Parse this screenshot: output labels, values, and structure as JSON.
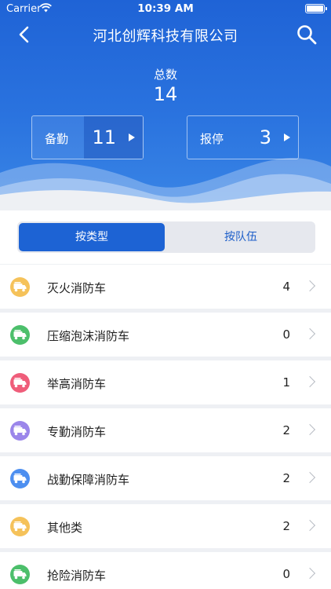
{
  "status_bar": {
    "carrier": "Carrier",
    "time": "10:39 AM"
  },
  "nav": {
    "title": "河北创辉科技有限公司",
    "back_icon": "chevron-left-icon",
    "search_icon": "search-icon"
  },
  "summary": {
    "total_label": "总数",
    "total_value": "14",
    "on_duty": {
      "label": "备勤",
      "value": "11"
    },
    "off_duty": {
      "label": "报停",
      "value": "3"
    }
  },
  "segment": {
    "by_type": "按类型",
    "by_team": "按队伍",
    "selected": "按类型"
  },
  "categories": [
    {
      "name": "灭火消防车",
      "count": "4",
      "icon": "fire-truck-icon",
      "color": "#f5c25a"
    },
    {
      "name": "压缩泡沫消防车",
      "count": "0",
      "icon": "fire-truck-icon",
      "color": "#4cbf6b"
    },
    {
      "name": "举高消防车",
      "count": "1",
      "icon": "fire-truck-icon",
      "color": "#ef5d7a"
    },
    {
      "name": "专勤消防车",
      "count": "2",
      "icon": "fire-truck-icon",
      "color": "#9b86ea"
    },
    {
      "name": "战勤保障消防车",
      "count": "2",
      "icon": "fire-truck-icon",
      "color": "#4d8ff0"
    },
    {
      "name": "其他类",
      "count": "2",
      "icon": "fire-truck-icon",
      "color": "#f5c25a"
    },
    {
      "name": "抢险消防车",
      "count": "0",
      "icon": "fire-truck-icon",
      "color": "#4cbf6b"
    }
  ],
  "colors": {
    "primary": "#1d63d4",
    "hero_top": "#1f63d6",
    "hero_bottom": "#3a86e6"
  }
}
